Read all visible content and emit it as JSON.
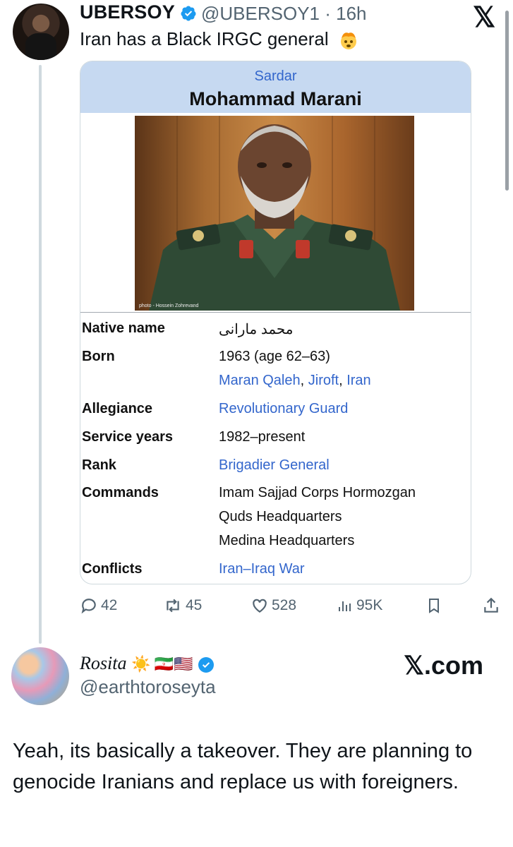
{
  "tweet": {
    "name": "UBERSOY",
    "handle_time": "@UBERSOY1 · 16h",
    "text": "Iran has a Black IRGC general",
    "emoji_icon": "exploding-head-emoji",
    "logo": "𝕏"
  },
  "infobox": {
    "title_prefix": "Sardar",
    "name": "Mohammad Marani",
    "photo_credit": "photo - Hossein Zohrevand",
    "rows": [
      {
        "label": "Native name",
        "values": [
          "محمد مارانی"
        ]
      },
      {
        "label": "Born",
        "values": [
          "1963 (age 62–63)"
        ]
      },
      {
        "label": "",
        "values": [
          "Maran Qaleh",
          ", ",
          "Jiroft",
          ", ",
          "Iran"
        ]
      },
      {
        "label": "Allegiance",
        "values": [
          "Revolutionary Guard"
        ]
      },
      {
        "label": "Service years",
        "values": [
          "1982–present"
        ]
      },
      {
        "label": "Rank",
        "values": [
          "Brigadier General"
        ]
      },
      {
        "label": "Commands",
        "values": [
          "Imam Sajjad Corps Hormozgan",
          "Quds Headquarters",
          "Medina Headquarters"
        ]
      },
      {
        "label": "Conflicts",
        "values": [
          "Iran–Iraq War"
        ]
      }
    ]
  },
  "actions": {
    "replies": "42",
    "reposts": "45",
    "likes": "528",
    "views": "95K"
  },
  "reply": {
    "name": "Rosita",
    "emojis": "☀️ 🇮🇷🇺🇸",
    "handle": "@earthtoroseyta",
    "site": "𝕏.com",
    "text": "Yeah, its basically a takeover. They are planning to genocide Iranians and replace us with foreigners."
  },
  "colors": {
    "link": "#3366cc",
    "verified": "#1d9bf0",
    "infobox_header": "#c6d9f1",
    "muted": "#536471"
  }
}
